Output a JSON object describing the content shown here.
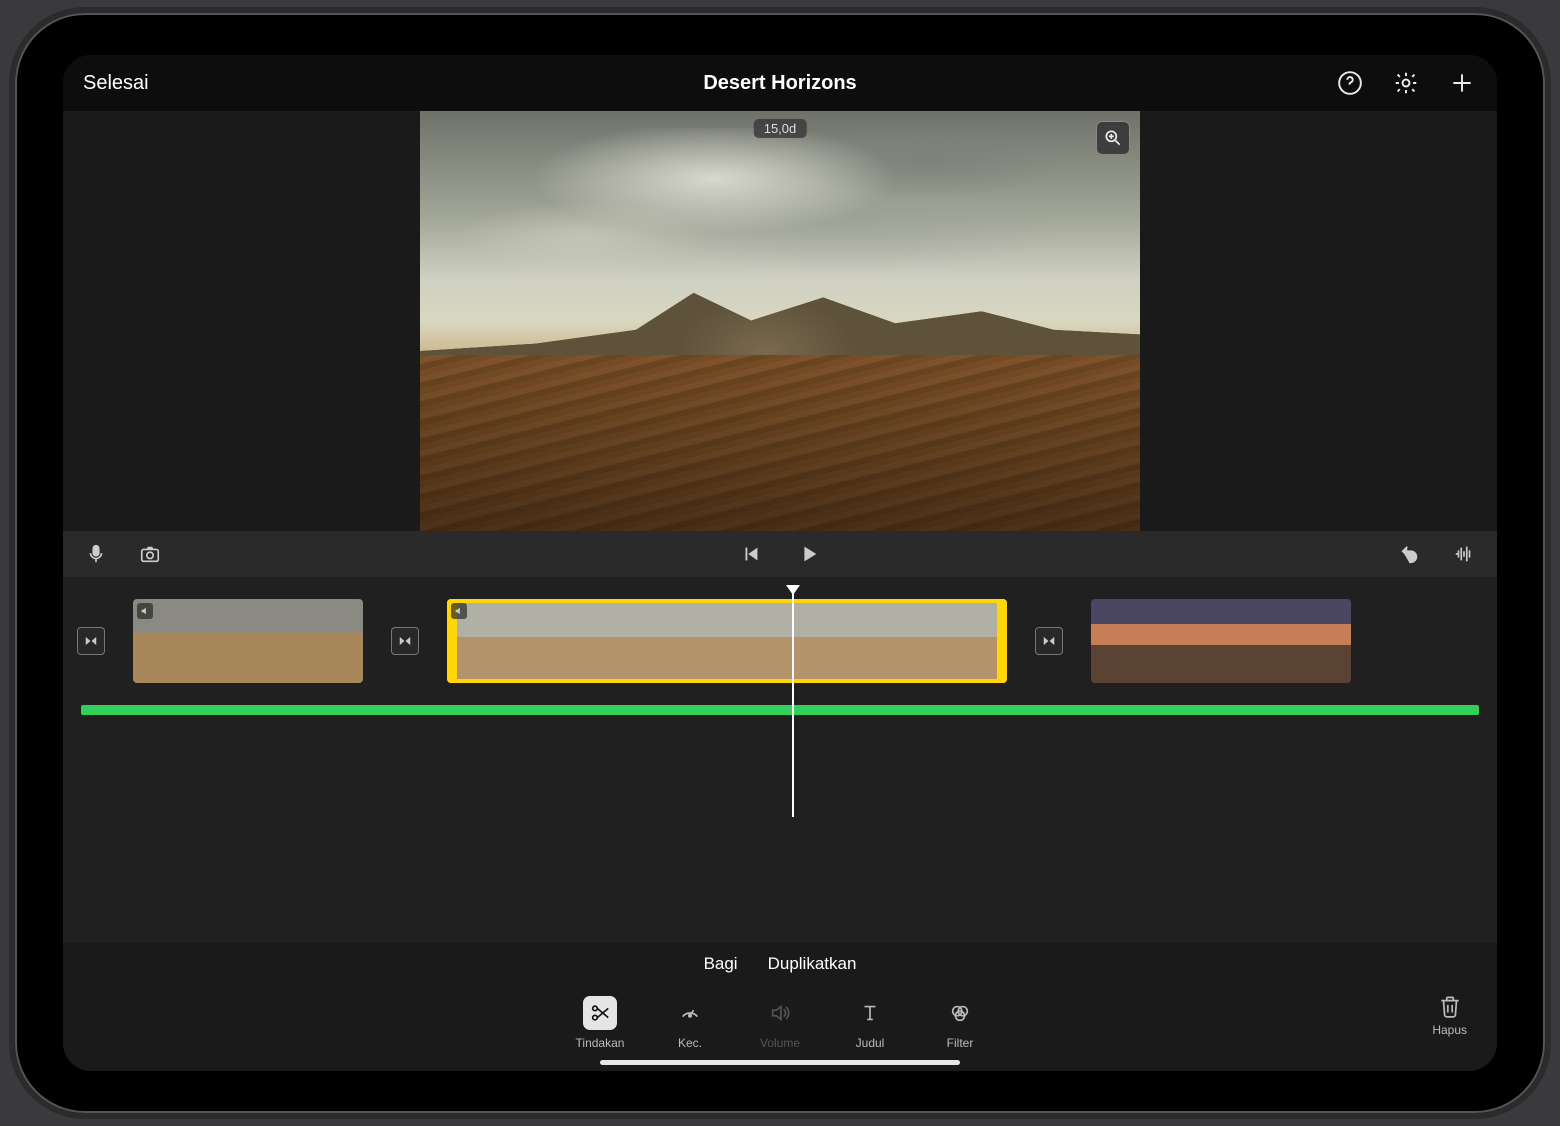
{
  "topbar": {
    "done_label": "Selesai",
    "title": "Desert Horizons"
  },
  "preview": {
    "timestamp": "15,0d"
  },
  "actions": {
    "split": "Bagi",
    "duplicate": "Duplikatkan"
  },
  "tools": {
    "actions": "Tindakan",
    "speed": "Kec.",
    "volume": "Volume",
    "title": "Judul",
    "filter": "Filter",
    "delete": "Hapus"
  }
}
